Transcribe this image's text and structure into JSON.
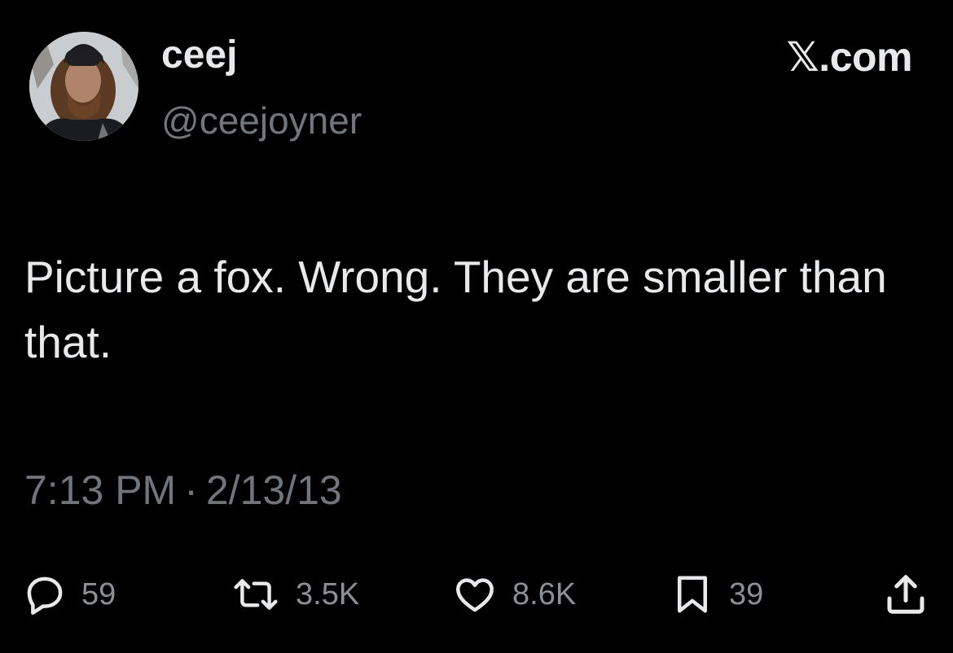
{
  "author": {
    "display_name": "ceej",
    "handle": "@ceejoyner",
    "avatar_icon": "profile-photo"
  },
  "brand": "𝕏.com",
  "tweet": {
    "text": "Picture a fox. Wrong. They are smaller than that.",
    "time": "7:13 PM",
    "separator": "·",
    "date": "2/13/13"
  },
  "actions": {
    "reply": {
      "icon": "reply-icon",
      "count": "59"
    },
    "retweet": {
      "icon": "retweet-icon",
      "count": "3.5K"
    },
    "like": {
      "icon": "heart-icon",
      "count": "8.6K"
    },
    "bookmark": {
      "icon": "bookmark-icon",
      "count": "39"
    },
    "share": {
      "icon": "share-icon"
    }
  },
  "colors": {
    "background": "#000000",
    "primary_text": "#e7e9ea",
    "secondary_text": "#71767b"
  }
}
